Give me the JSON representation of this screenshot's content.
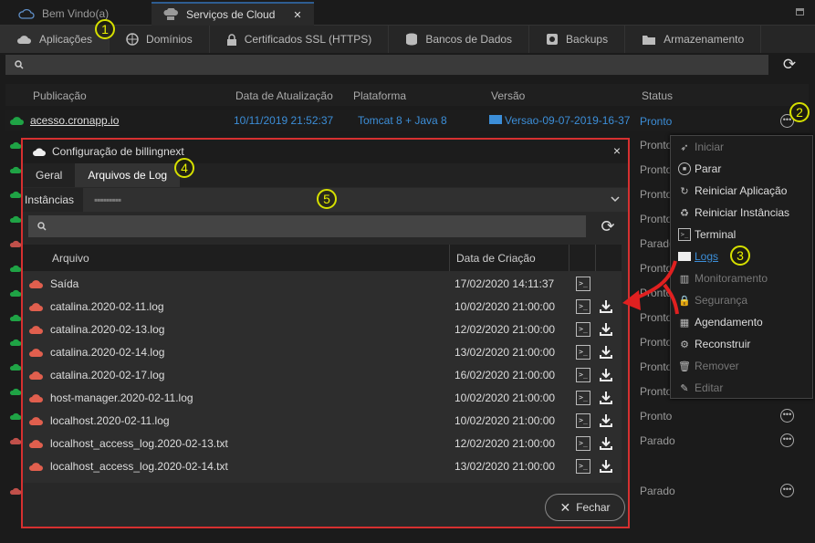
{
  "window_tabs": [
    {
      "label": "Bem Vindo(a)",
      "icon": "cloud-outline-icon"
    },
    {
      "label": "Serviços de Cloud",
      "icon": "cloud-server-icon",
      "close": "✕"
    }
  ],
  "nav_tabs": [
    {
      "label": "Aplicações",
      "icon": "cloud-upload-icon"
    },
    {
      "label": "Domínios",
      "icon": "globe-icon"
    },
    {
      "label": "Certificados SSL (HTTPS)",
      "icon": "lock-icon"
    },
    {
      "label": "Bancos de Dados",
      "icon": "database-icon"
    },
    {
      "label": "Backups",
      "icon": "backup-icon"
    },
    {
      "label": "Armazenamento",
      "icon": "folder-icon"
    }
  ],
  "table": {
    "headers": [
      "Publicação",
      "Data de Atualização",
      "Plataforma",
      "Versão",
      "Status"
    ],
    "first_row": {
      "publication": "acesso.cronapp.io",
      "updated": "10/11/2019 21:52:37",
      "platform": "Tomcat 8 + Java 8",
      "version": "Versao-09-07-2019-16-37",
      "status": "Pronto"
    },
    "statuses": [
      "Pronto",
      "Pronto",
      "Pronto",
      "Pronto",
      "Pronto",
      "Parado",
      "Pronto",
      "Pronto",
      "Pronto",
      "Pronto",
      "Pronto",
      "Pronto",
      "Pronto",
      "Parado",
      "Parado"
    ]
  },
  "context_menu": [
    {
      "label": "Iniciar",
      "icon": "rocket-icon",
      "enabled": false
    },
    {
      "label": "Parar",
      "icon": "stop-icon",
      "enabled": true
    },
    {
      "label": "Reiniciar Aplicação",
      "icon": "restart-icon",
      "enabled": true
    },
    {
      "label": "Reiniciar Instâncias",
      "icon": "restart-instances-icon",
      "enabled": true
    },
    {
      "label": "Terminal",
      "icon": "terminal-icon",
      "enabled": true
    },
    {
      "label": "Logs",
      "icon": "logs-icon",
      "enabled": true,
      "highlight": true
    },
    {
      "label": "Monitoramento",
      "icon": "monitor-icon",
      "enabled": false
    },
    {
      "label": "Segurança",
      "icon": "lock-icon",
      "enabled": false
    },
    {
      "label": "Agendamento",
      "icon": "calendar-icon",
      "enabled": true
    },
    {
      "label": "Reconstruir",
      "icon": "gears-icon",
      "enabled": true
    },
    {
      "label": "Remover",
      "icon": "trash-icon",
      "enabled": false
    },
    {
      "label": "Editar",
      "icon": "edit-icon",
      "enabled": false
    }
  ],
  "modal": {
    "title": "Configuração de billingnext",
    "close": "×",
    "tabs": [
      "Geral",
      "Arquivos de Log"
    ],
    "instances_label": "Instâncias",
    "instance_value": "▪▪▪▪▪▪▪▪▪",
    "headers": {
      "file": "Arquivo",
      "date": "Data de Criação"
    },
    "terminal_glyph": ">_",
    "download_glyph": "⤓",
    "files": [
      {
        "name": "Saída",
        "date": "17/02/2020 14:11:37",
        "download": false
      },
      {
        "name": "catalina.2020-02-11.log",
        "date": "10/02/2020 21:00:00",
        "download": true
      },
      {
        "name": "catalina.2020-02-13.log",
        "date": "12/02/2020 21:00:00",
        "download": true
      },
      {
        "name": "catalina.2020-02-14.log",
        "date": "13/02/2020 21:00:00",
        "download": true
      },
      {
        "name": "catalina.2020-02-17.log",
        "date": "16/02/2020 21:00:00",
        "download": true
      },
      {
        "name": "host-manager.2020-02-11.log",
        "date": "10/02/2020 21:00:00",
        "download": true
      },
      {
        "name": "localhost.2020-02-11.log",
        "date": "10/02/2020 21:00:00",
        "download": true
      },
      {
        "name": "localhost_access_log.2020-02-13.txt",
        "date": "12/02/2020 21:00:00",
        "download": true
      },
      {
        "name": "localhost_access_log.2020-02-14.txt",
        "date": "13/02/2020 21:00:00",
        "download": true
      }
    ],
    "close_button": "Fechar"
  },
  "callouts": [
    "1",
    "2",
    "3",
    "4",
    "5"
  ],
  "colors": {
    "accent_red": "#d63030",
    "callout": "#d6e000",
    "link_blue": "#3c8ed8",
    "green_cloud": "#1fa345",
    "red_cloud": "#e05f4e"
  }
}
